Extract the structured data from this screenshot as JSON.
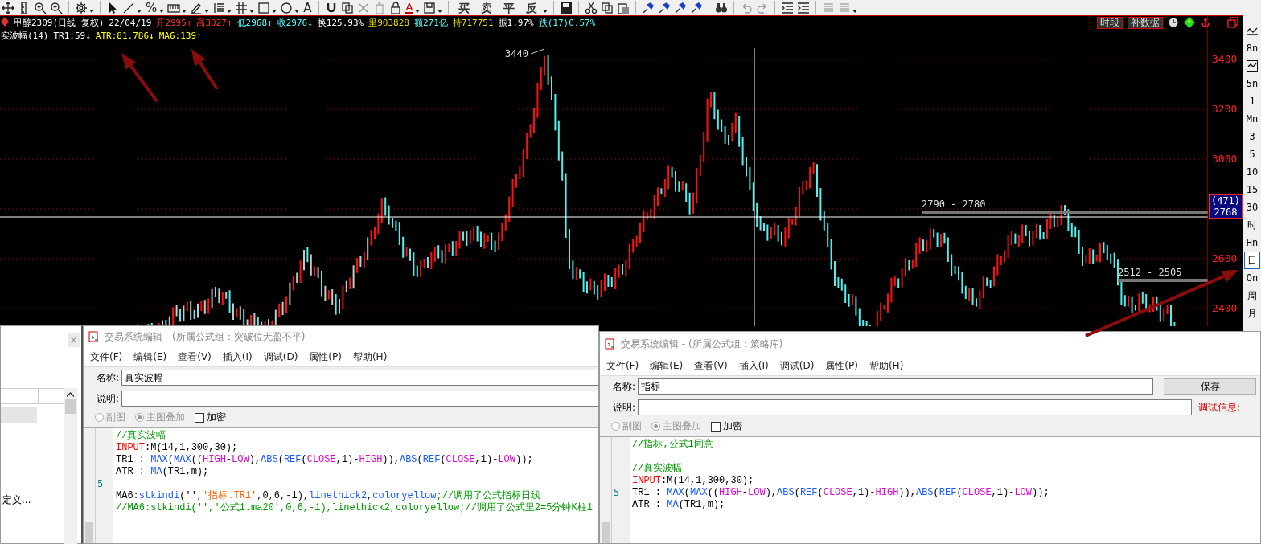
{
  "toolbar": {
    "percent_glyph": "%",
    "text_glyph": "A",
    "font_color_glyph": "A",
    "trade_buttons": [
      "买",
      "卖",
      "平",
      "反"
    ]
  },
  "chart": {
    "quote": [
      {
        "text": "甲醇2309(日线 复权)",
        "color": "#ffffff"
      },
      {
        "text": "22/04/19",
        "color": "#ffffff"
      },
      {
        "text": "开2995↑",
        "color": "#ff3232"
      },
      {
        "text": "高3027↑",
        "color": "#ff3232"
      },
      {
        "text": "低2968↑",
        "color": "#54ffff"
      },
      {
        "text": "收2976↓",
        "color": "#54ffff"
      },
      {
        "text": "换125.93%",
        "color": "#ffffff"
      },
      {
        "text": "里903828",
        "color": "#e8d800"
      },
      {
        "text": "额271亿",
        "color": "#54ffff"
      },
      {
        "text": "持717751",
        "color": "#e8d800"
      },
      {
        "text": "振1.97%",
        "color": "#ffffff"
      },
      {
        "text": "跌(17)0.57%",
        "color": "#54ffff"
      }
    ],
    "indicator": [
      {
        "text": "实波幅(14)",
        "color": "#ffffff"
      },
      {
        "text": "TR1:59↓",
        "color": "#ffffff"
      },
      {
        "text": "ATR:81.786↓",
        "color": "#ffff00"
      },
      {
        "text": "MA6:139↑",
        "color": "#ffff00"
      }
    ],
    "buttons": [
      "时段",
      "补数据"
    ],
    "axis_labels": [
      "3400",
      "3200",
      "3000",
      "2600",
      "2400"
    ],
    "cursor_label": {
      "count": "(471)",
      "price": "2768"
    },
    "peak_label": "3440",
    "level_labels": [
      "2790 - 2780",
      "2512 - 2505"
    ]
  },
  "period_bar": {
    "items": [
      {
        "kind": "icon",
        "selected": false
      },
      {
        "kind": "text",
        "label": "8n",
        "selected": false
      },
      {
        "kind": "icon",
        "selected": false
      },
      {
        "kind": "text",
        "label": "5n",
        "selected": false
      },
      {
        "kind": "text",
        "label": "1",
        "selected": false
      },
      {
        "kind": "text",
        "label": "Mn",
        "selected": false
      },
      {
        "kind": "text",
        "label": "3",
        "selected": false
      },
      {
        "kind": "text",
        "label": "5",
        "selected": false
      },
      {
        "kind": "text",
        "label": "10",
        "selected": false
      },
      {
        "kind": "text",
        "label": "15",
        "selected": false
      },
      {
        "kind": "text",
        "label": "30",
        "selected": false
      },
      {
        "kind": "text",
        "label": "时",
        "selected": false
      },
      {
        "kind": "text",
        "label": "Hn",
        "selected": false
      },
      {
        "kind": "text",
        "label": "日",
        "selected": true
      },
      {
        "kind": "text",
        "label": "On",
        "selected": false
      },
      {
        "kind": "text",
        "label": "周",
        "selected": false
      },
      {
        "kind": "text",
        "label": "月",
        "selected": false
      }
    ]
  },
  "side_panel": {
    "close": "×",
    "items": [
      "定义..."
    ]
  },
  "editors": [
    {
      "title": "交易系统编辑 - (所属公式组：突破位无盈不平)",
      "menus": [
        "文件(F)",
        "编辑(E)",
        "查看(V)",
        "插入(I)",
        "调试(D)",
        "属性(P)",
        "帮助(H)"
      ],
      "name_label": "名称:",
      "name_value": "真实波幅",
      "desc_label": "说明:",
      "options": [
        {
          "kind": "radio",
          "label": "副图",
          "checked": false,
          "disabled": true
        },
        {
          "kind": "radio",
          "label": "主图叠加",
          "checked": true,
          "disabled": true
        },
        {
          "kind": "checkbox",
          "label": "加密",
          "checked": false,
          "disabled": false
        }
      ],
      "code": [
        {
          "tokens": [
            {
              "text": "//真实波幅",
              "kind": "comment"
            }
          ]
        },
        {
          "tokens": [
            {
              "text": "INPUT",
              "kind": "keyword"
            },
            {
              "text": ":M(14,1,300,30);",
              "kind": "plain"
            }
          ]
        },
        {
          "tokens": [
            {
              "text": "TR1 : ",
              "kind": "plain"
            },
            {
              "text": "MAX",
              "kind": "function"
            },
            {
              "text": "(",
              "kind": "plain"
            },
            {
              "text": "MAX",
              "kind": "function"
            },
            {
              "text": "((",
              "kind": "plain"
            },
            {
              "text": "HIGH",
              "kind": "variable"
            },
            {
              "text": "-",
              "kind": "plain"
            },
            {
              "text": "LOW",
              "kind": "variable"
            },
            {
              "text": "),",
              "kind": "plain"
            },
            {
              "text": "ABS",
              "kind": "function"
            },
            {
              "text": "(",
              "kind": "plain"
            },
            {
              "text": "REF",
              "kind": "function"
            },
            {
              "text": "(",
              "kind": "plain"
            },
            {
              "text": "CLOSE",
              "kind": "variable"
            },
            {
              "text": ",1)-",
              "kind": "plain"
            },
            {
              "text": "HIGH",
              "kind": "variable"
            },
            {
              "text": ")),",
              "kind": "plain"
            },
            {
              "text": "ABS",
              "kind": "function"
            },
            {
              "text": "(",
              "kind": "plain"
            },
            {
              "text": "REF",
              "kind": "function"
            },
            {
              "text": "(",
              "kind": "plain"
            },
            {
              "text": "CLOSE",
              "kind": "variable"
            },
            {
              "text": ",1)-",
              "kind": "plain"
            },
            {
              "text": "LOW",
              "kind": "variable"
            },
            {
              "text": "));",
              "kind": "plain"
            }
          ]
        },
        {
          "tokens": [
            {
              "text": "ATR : ",
              "kind": "plain"
            },
            {
              "text": "MA",
              "kind": "function"
            },
            {
              "text": "(TR1,m);",
              "kind": "plain"
            }
          ]
        },
        {
          "number": "5"
        },
        {
          "tokens": [
            {
              "text": "MA6:",
              "kind": "plain"
            },
            {
              "text": "stkindi",
              "kind": "function"
            },
            {
              "text": "('',",
              "kind": "plain"
            },
            {
              "text": "'指标.TR1'",
              "kind": "string"
            },
            {
              "text": ",0,6,-1),",
              "kind": "plain"
            },
            {
              "text": "linethick2",
              "kind": "function"
            },
            {
              "text": ",",
              "kind": "plain"
            },
            {
              "text": "coloryellow",
              "kind": "function"
            },
            {
              "text": ";//调用了公式指标日线",
              "kind": "comment"
            }
          ]
        },
        {
          "tokens": [
            {
              "text": "//MA6:stkindi('','公式1.ma20',0,6,-1),linethick2,coloryellow;//调用了公式里2=5分钟K柱1",
              "kind": "comment"
            }
          ]
        }
      ]
    },
    {
      "title": "交易系统编辑 - (所属公式组：策略库)",
      "menus": [
        "文件(F)",
        "编辑(E)",
        "查看(V)",
        "插入(I)",
        "调试(D)",
        "属性(P)",
        "帮助(H)"
      ],
      "name_label": "名称:",
      "name_value": "指标",
      "desc_label": "说明:",
      "save_button": "保存",
      "debug_label": "调试信息:",
      "options": [
        {
          "kind": "radio",
          "label": "副图",
          "checked": false,
          "disabled": true
        },
        {
          "kind": "radio",
          "label": "主图叠加",
          "checked": true,
          "disabled": true
        },
        {
          "kind": "checkbox",
          "label": "加密",
          "checked": false,
          "disabled": false
        }
      ],
      "code": [
        {
          "kind": "code",
          "tokens": [
            {
              "text": "//指标,公式1同意",
              "kind": "comment"
            }
          ]
        },
        {
          "kind": "blank"
        },
        {
          "kind": "code",
          "tokens": [
            {
              "text": "//真实波幅",
              "kind": "comment"
            }
          ]
        },
        {
          "kind": "code",
          "tokens": [
            {
              "text": "INPUT",
              "kind": "keyword"
            },
            {
              "text": ":M(14,1,300,30);",
              "kind": "plain"
            }
          ]
        },
        {
          "kind": "code",
          "number": "5",
          "tokens": [
            {
              "text": "TR1 : ",
              "kind": "plain"
            },
            {
              "text": "MAX",
              "kind": "function"
            },
            {
              "text": "(",
              "kind": "plain"
            },
            {
              "text": "MAX",
              "kind": "function"
            },
            {
              "text": "((",
              "kind": "plain"
            },
            {
              "text": "HIGH",
              "kind": "variable"
            },
            {
              "text": "-",
              "kind": "plain"
            },
            {
              "text": "LOW",
              "kind": "variable"
            },
            {
              "text": "),",
              "kind": "plain"
            },
            {
              "text": "ABS",
              "kind": "function"
            },
            {
              "text": "(",
              "kind": "plain"
            },
            {
              "text": "REF",
              "kind": "function"
            },
            {
              "text": "(",
              "kind": "plain"
            },
            {
              "text": "CLOSE",
              "kind": "variable"
            },
            {
              "text": ",1)-",
              "kind": "plain"
            },
            {
              "text": "HIGH",
              "kind": "variable"
            },
            {
              "text": ")),",
              "kind": "plain"
            },
            {
              "text": "ABS",
              "kind": "function"
            },
            {
              "text": "(",
              "kind": "plain"
            },
            {
              "text": "REF",
              "kind": "function"
            },
            {
              "text": "(",
              "kind": "plain"
            },
            {
              "text": "CLOSE",
              "kind": "variable"
            },
            {
              "text": ",1)-",
              "kind": "plain"
            },
            {
              "text": "LOW",
              "kind": "variable"
            },
            {
              "text": "));",
              "kind": "plain"
            }
          ]
        },
        {
          "kind": "code",
          "tokens": [
            {
              "text": "ATR : ",
              "kind": "plain"
            },
            {
              "text": "MA",
              "kind": "function"
            },
            {
              "text": "(TR1,m);",
              "kind": "plain"
            }
          ]
        }
      ]
    }
  ]
}
